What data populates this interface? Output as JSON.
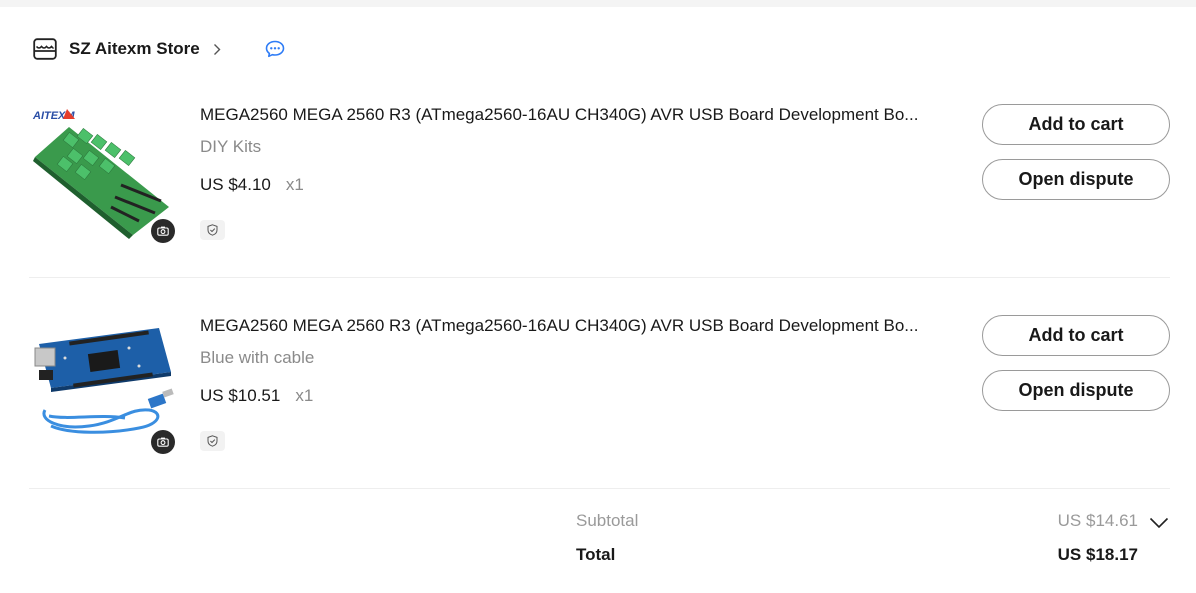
{
  "store": {
    "name": "SZ Aitexm Store",
    "icons": {
      "store": "store-icon",
      "chevron": "chevron-right-icon",
      "chat": "chat-icon"
    }
  },
  "items": [
    {
      "title": "MEGA2560 MEGA 2560 R3 (ATmega2560-16AU CH340G) AVR USB Board Development Bo...",
      "variant": "DIY Kits",
      "price": "US $4.10",
      "qty": "x1",
      "thumb_logo": "AITEXM",
      "add_to_cart": "Add to cart",
      "open_dispute": "Open dispute"
    },
    {
      "title": "MEGA2560 MEGA 2560 R3 (ATmega2560-16AU CH340G) AVR USB Board Development Bo...",
      "variant": "Blue with cable",
      "price": "US $10.51",
      "qty": "x1",
      "add_to_cart": "Add to cart",
      "open_dispute": "Open dispute"
    }
  ],
  "summary": {
    "subtotal_label": "Subtotal",
    "subtotal_value": "US $14.61",
    "total_label": "Total",
    "total_value": "US $18.17"
  },
  "colors": {
    "accent": "#2e7cf6",
    "text": "#191919",
    "muted": "#8a8a8a",
    "border": "#9a9a9a"
  }
}
